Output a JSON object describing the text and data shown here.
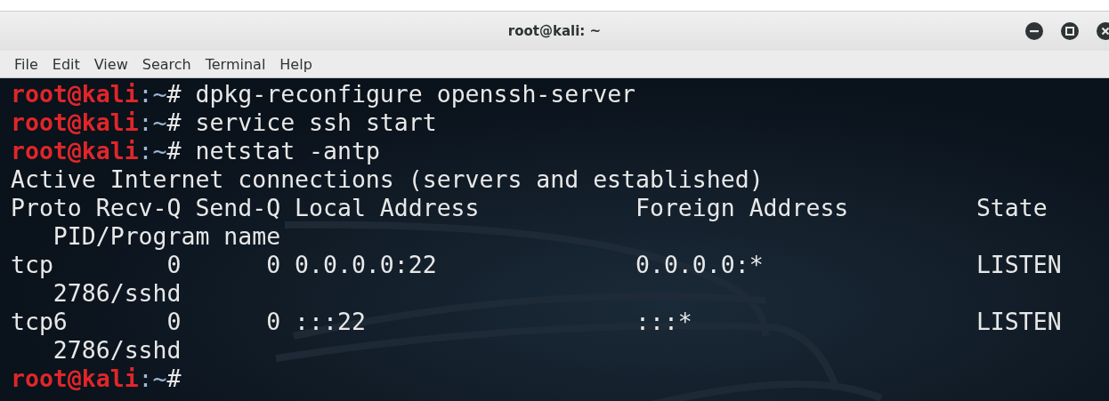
{
  "window": {
    "title": "root@kali: ~",
    "controls": [
      {
        "kind": "minimize"
      },
      {
        "kind": "maximize"
      },
      {
        "kind": "close"
      }
    ]
  },
  "menu": [
    "File",
    "Edit",
    "View",
    "Search",
    "Terminal",
    "Help"
  ],
  "terminal": {
    "lines": [
      {
        "kind": "prompt",
        "user_host": "root@kali",
        "path": ":~",
        "symbol": "#",
        "command": "dpkg-reconfigure openssh-server"
      },
      {
        "kind": "prompt",
        "user_host": "root@kali",
        "path": ":~",
        "symbol": "#",
        "command": "service ssh start"
      },
      {
        "kind": "prompt",
        "user_host": "root@kali",
        "path": ":~",
        "symbol": "#",
        "command": "netstat -antp"
      },
      {
        "kind": "output",
        "text": "Active Internet connections (servers and established)"
      },
      {
        "kind": "output",
        "text": "Proto Recv-Q Send-Q Local Address           Foreign Address         State"
      },
      {
        "kind": "output",
        "text": "   PID/Program name"
      },
      {
        "kind": "output",
        "text": "tcp        0      0 0.0.0.0:22              0.0.0.0:*               LISTEN"
      },
      {
        "kind": "output",
        "text": "   2786/sshd"
      },
      {
        "kind": "output",
        "text": "tcp6       0      0 :::22                   :::*                    LISTEN"
      },
      {
        "kind": "output",
        "text": "   2786/sshd"
      },
      {
        "kind": "prompt",
        "user_host": "root@kali",
        "path": ":~",
        "symbol": "#"
      }
    ]
  }
}
